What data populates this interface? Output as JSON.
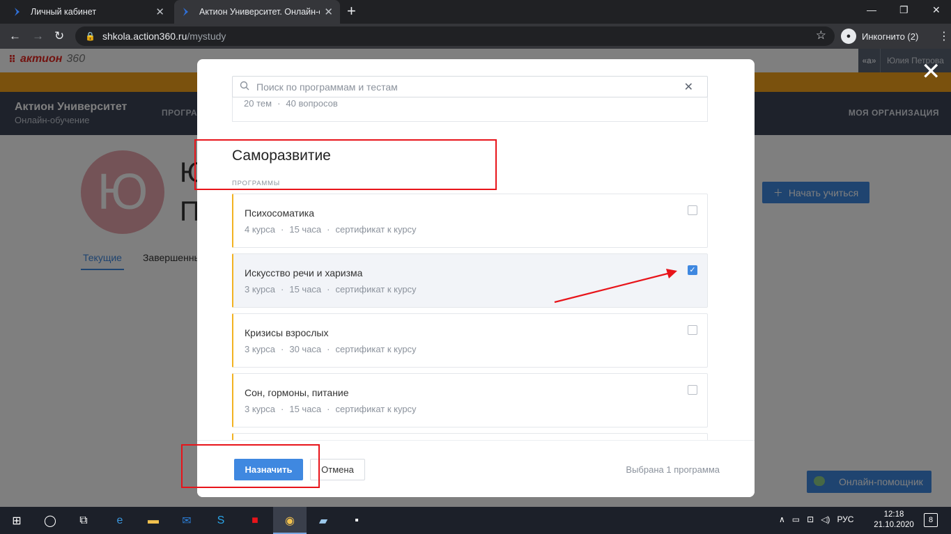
{
  "browser": {
    "tabs": [
      {
        "label": "Личный кабинет"
      },
      {
        "label": "Актион Университет. Онлайн-об"
      }
    ],
    "url_host": "shkola.action360.ru",
    "url_path": "/mystudy",
    "incognito_label": "Инкогнито (2)"
  },
  "site": {
    "brand": "актион",
    "brand_num": "360",
    "user_badge": "«а»",
    "user_name": "Юлия Петрова",
    "univ_title": "Актион Университет",
    "univ_sub": "Онлайн-обучение",
    "nav_programs": "ПРОГРАММЫ",
    "nav_org": "МОЯ ОРГАНИЗАЦИЯ",
    "avatar_letter": "Ю",
    "name_line1": "Ю",
    "name_line2": "П",
    "start_button": "Начать учиться",
    "tab_current": "Текущие",
    "tab_done": "Завершенные",
    "helper": "Онлайн-помощник"
  },
  "modal": {
    "search_placeholder": "Поиск по программам и тестам",
    "prev_meta": {
      "topics": "20 тем",
      "questions": "40 вопросов"
    },
    "section_title": "Саморазвитие",
    "section_sub": "ПРОГРАММЫ",
    "programs": [
      {
        "title": "Психосоматика",
        "courses": "4 курса",
        "hours": "15 часа",
        "cert": "сертификат к курсу",
        "checked": false
      },
      {
        "title": "Искусство речи и харизма",
        "courses": "3 курса",
        "hours": "15 часа",
        "cert": "сертификат к курсу",
        "checked": true
      },
      {
        "title": "Кризисы взрослых",
        "courses": "3 курса",
        "hours": "30 часа",
        "cert": "сертификат к курсу",
        "checked": false
      },
      {
        "title": "Сон, гормоны, питание",
        "courses": "3 курса",
        "hours": "15 часа",
        "cert": "сертификат к курсу",
        "checked": false
      }
    ],
    "assign_button": "Назначить",
    "cancel_button": "Отмена",
    "selected_info": "Выбрана 1 программа"
  },
  "taskbar": {
    "lang": "РУС",
    "time": "12:18",
    "date": "21.10.2020",
    "notifications": "8"
  },
  "colors": {
    "accent": "#3f88e0",
    "annotation": "#e8141a",
    "orange": "#f5a31a",
    "navband": "#3c4457"
  }
}
